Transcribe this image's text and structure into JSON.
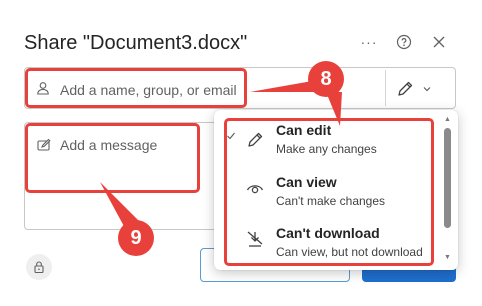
{
  "dialog": {
    "title": "Share \"Document3.docx\"",
    "more_icon": "ellipsis-icon",
    "help_icon": "question-circle-icon",
    "close_icon": "close-icon"
  },
  "recipients": {
    "placeholder": "Add a name, group, or email",
    "icon": "person-icon",
    "permission_icon": "pencil-icon",
    "chevron_icon": "chevron-down-icon"
  },
  "message": {
    "placeholder": "Add a message",
    "icon": "compose-icon"
  },
  "permission_menu": {
    "options": [
      {
        "label": "Can edit",
        "description": "Make any changes",
        "icon": "pencil-icon",
        "selected": true
      },
      {
        "label": "Can view",
        "description": "Can't make changes",
        "icon": "eye-icon",
        "selected": false
      },
      {
        "label": "Can't download",
        "description": "Can view, but not download",
        "icon": "no-download-icon",
        "selected": false
      }
    ]
  },
  "annotations": {
    "badge_8": "8",
    "badge_9": "9",
    "color": "#e8413c"
  },
  "footer": {
    "lock_icon": "lock-icon"
  }
}
